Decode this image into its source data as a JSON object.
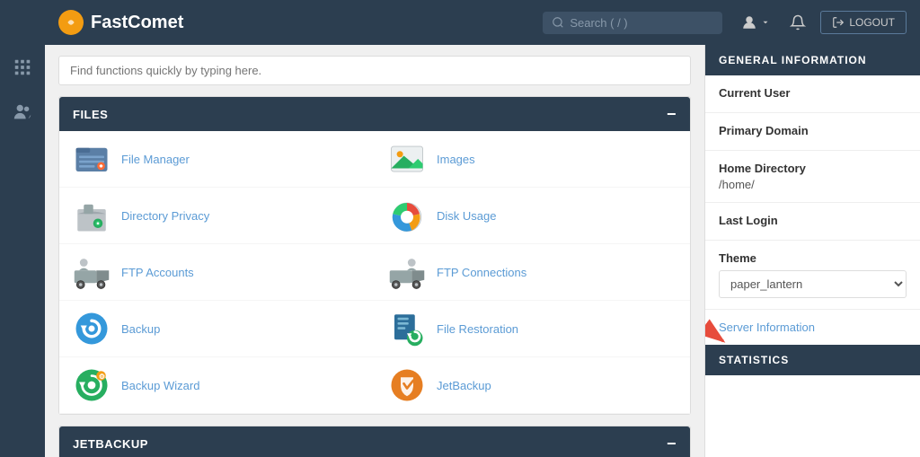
{
  "header": {
    "logo_text": "FastComet",
    "search_placeholder": "Search ( / )",
    "logout_label": "LOGOUT"
  },
  "quick_find": {
    "placeholder": "Find functions quickly by typing here."
  },
  "files_section": {
    "title": "FILES",
    "items": [
      {
        "id": "file-manager",
        "label": "File Manager",
        "icon": "file-manager-icon"
      },
      {
        "id": "images",
        "label": "Images",
        "icon": "images-icon"
      },
      {
        "id": "directory-privacy",
        "label": "Directory Privacy",
        "icon": "dir-privacy-icon"
      },
      {
        "id": "disk-usage",
        "label": "Disk Usage",
        "icon": "disk-usage-icon"
      },
      {
        "id": "ftp-accounts",
        "label": "FTP Accounts",
        "icon": "ftp-accounts-icon"
      },
      {
        "id": "ftp-connections",
        "label": "FTP Connections",
        "icon": "ftp-connections-icon"
      },
      {
        "id": "backup",
        "label": "Backup",
        "icon": "backup-icon"
      },
      {
        "id": "file-restoration",
        "label": "File Restoration",
        "icon": "file-restoration-icon"
      },
      {
        "id": "backup-wizard",
        "label": "Backup Wizard",
        "icon": "backup-wizard-icon"
      },
      {
        "id": "jetbackup",
        "label": "JetBackup",
        "icon": "jetbackup-icon"
      }
    ]
  },
  "jetbackup_section": {
    "title": "JETBACKUP"
  },
  "general_info": {
    "title": "GENERAL INFORMATION",
    "current_user_label": "Current User",
    "current_user_value": "",
    "primary_domain_label": "Primary Domain",
    "primary_domain_value": "",
    "home_directory_label": "Home Directory",
    "home_directory_value": "/home/",
    "last_login_label": "Last Login",
    "last_login_value": "",
    "theme_label": "Theme",
    "theme_value": "paper_lantern",
    "server_info_label": "Server Information"
  },
  "statistics": {
    "title": "STATISTICS"
  },
  "sidebar_icons": {
    "grid_icon": "⊞",
    "users_icon": "👥"
  }
}
